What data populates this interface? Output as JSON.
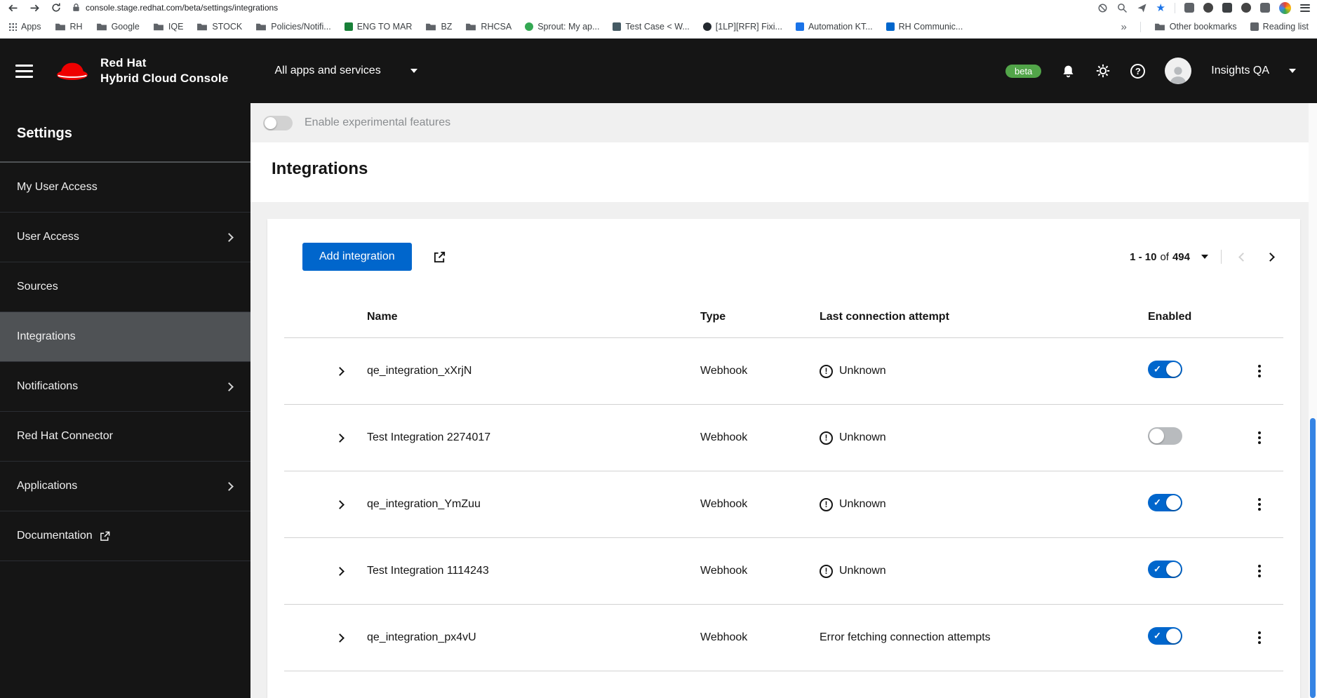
{
  "icons": {
    "star": "★",
    "check": "✓",
    "unknown_status": "!",
    "help": "?"
  },
  "colors": {
    "primary": "#0066cc",
    "beta_green": "#52a549",
    "header_bg": "#151515",
    "scrollbar_thumb": "#3584e4",
    "bookmark_star": "#1a73e8"
  },
  "browser": {
    "url": "console.stage.redhat.com/beta/settings/integrations",
    "bookmarks": [
      {
        "label": "Apps",
        "icon": "grid"
      },
      {
        "label": "RH",
        "icon": "folder"
      },
      {
        "label": "Google",
        "icon": "folder"
      },
      {
        "label": "IQE",
        "icon": "folder"
      },
      {
        "label": "STOCK",
        "icon": "folder"
      },
      {
        "label": "Policies/Notifi...",
        "icon": "folder"
      },
      {
        "label": "ENG TO MAR",
        "icon": "dot",
        "dot_style": "background:#188038"
      },
      {
        "label": "BZ",
        "icon": "folder"
      },
      {
        "label": "RHCSA",
        "icon": "folder"
      },
      {
        "label": "Sprout: My ap...",
        "icon": "dot",
        "dot_style": "background:#34a853;border-radius:50%"
      },
      {
        "label": "Test Case < W...",
        "icon": "dot",
        "dot_style": "background:#455a64"
      },
      {
        "label": "[1LP][RFR] Fixi...",
        "icon": "dot",
        "dot_style": "background:#24292f;border-radius:50%"
      },
      {
        "label": "Automation KT...",
        "icon": "dot",
        "dot_style": "background:#1a73e8"
      },
      {
        "label": "RH Communic...",
        "icon": "dot",
        "dot_style": "background:#0066cc"
      },
      {
        "label": "»",
        "icon": "none"
      },
      {
        "label": "Other bookmarks",
        "icon": "folder"
      },
      {
        "label": "Reading list",
        "icon": "dot",
        "dot_style": "background:#5f6368"
      }
    ]
  },
  "app_header": {
    "brand_line1": "Red Hat",
    "brand_line2": "Hybrid Cloud Console",
    "app_selector_label": "All apps and services",
    "beta_badge": "beta",
    "username": "Insights QA"
  },
  "sidebar": {
    "title": "Settings",
    "items": [
      {
        "label": "My User Access"
      },
      {
        "label": "User Access",
        "expandable": true
      },
      {
        "label": "Sources"
      },
      {
        "label": "Integrations",
        "selected": true
      },
      {
        "label": "Notifications",
        "expandable": true
      },
      {
        "label": "Red Hat Connector"
      },
      {
        "label": "Applications",
        "expandable": true
      },
      {
        "label": "Documentation",
        "external": true
      }
    ]
  },
  "main": {
    "experimental": {
      "label": "Enable experimental features",
      "enabled": false
    },
    "page_title": "Integrations",
    "toolbar": {
      "add_button_label": "Add integration",
      "pagination": {
        "range": "1 - 10",
        "of": "of",
        "total": "494"
      }
    },
    "table": {
      "columns": {
        "name": "Name",
        "type": "Type",
        "last_connection": "Last connection attempt",
        "enabled": "Enabled"
      },
      "rows": [
        {
          "name": "qe_integration_xXrjN",
          "type": "Webhook",
          "last_connection": "Unknown",
          "status_icon": true,
          "enabled": true
        },
        {
          "name": "Test Integration 2274017",
          "type": "Webhook",
          "last_connection": "Unknown",
          "status_icon": true,
          "enabled": false
        },
        {
          "name": "qe_integration_YmZuu",
          "type": "Webhook",
          "last_connection": "Unknown",
          "status_icon": true,
          "enabled": true
        },
        {
          "name": "Test Integration 1114243",
          "type": "Webhook",
          "last_connection": "Unknown",
          "status_icon": true,
          "enabled": true
        },
        {
          "name": "qe_integration_px4vU",
          "type": "Webhook",
          "last_connection": "Error fetching connection attempts",
          "status_icon": false,
          "enabled": true
        }
      ]
    }
  }
}
